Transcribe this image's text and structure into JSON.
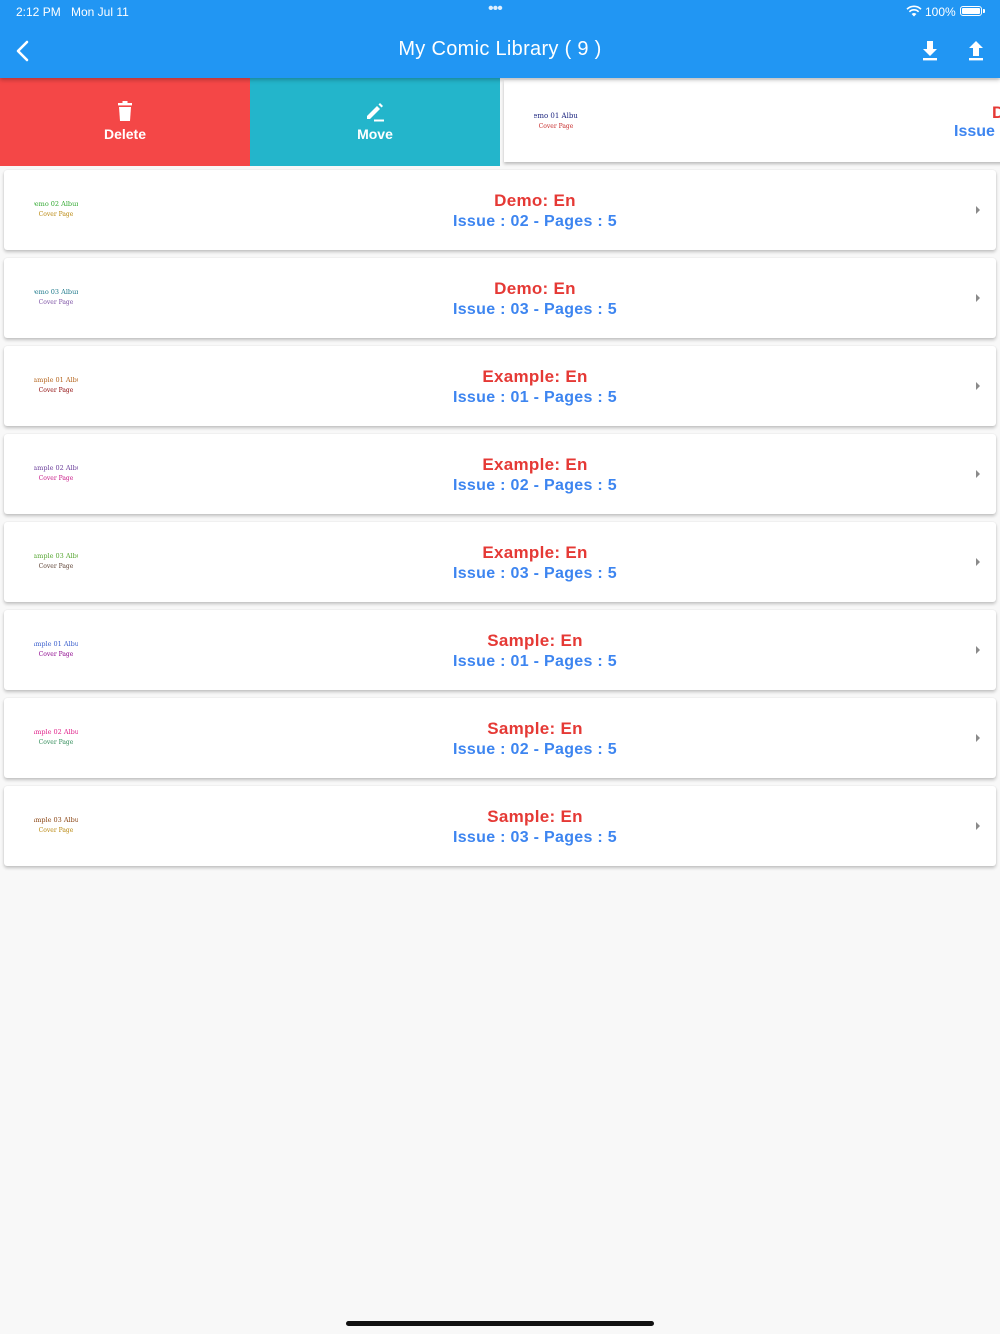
{
  "status_bar": {
    "time": "2:12 PM",
    "date": "Mon Jul 11",
    "dots": "•••",
    "battery": "100%"
  },
  "header": {
    "title": "My Comic Library ( 9 )",
    "back_icon": "chevron-left-icon",
    "download_icon": "download-icon",
    "upload_icon": "upload-icon"
  },
  "swipe_actions": {
    "delete_label": "Delete",
    "move_label": "Move"
  },
  "slid_item": {
    "title": "D",
    "subtitle": "Issue",
    "thumb_line1": "Demo 01 Album",
    "thumb_line2": "Cover Page"
  },
  "items": [
    {
      "title": "Demo: En",
      "subtitle": "Issue : 02 - Pages : 5",
      "thumb_line1": "Demo 02 Album",
      "thumb_line2": "Cover Page",
      "thumb_color1": "#33aa33",
      "thumb_color2": "#b8860b"
    },
    {
      "title": "Demo: En",
      "subtitle": "Issue : 03 - Pages : 5",
      "thumb_line1": "Demo 03 Album",
      "thumb_line2": "Cover Page",
      "thumb_color1": "#1f7a8c",
      "thumb_color2": "#7a4ea3"
    },
    {
      "title": "Example: En",
      "subtitle": "Issue : 01 - Pages : 5",
      "thumb_line1": "Example 01 Album",
      "thumb_line2": "Cover Page",
      "thumb_color1": "#b5651d",
      "thumb_color2": "#8b0000"
    },
    {
      "title": "Example: En",
      "subtitle": "Issue : 02 - Pages : 5",
      "thumb_line1": "Example 02 Album",
      "thumb_line2": "Cover Page",
      "thumb_color1": "#6a3d9a",
      "thumb_color2": "#c71585"
    },
    {
      "title": "Example: En",
      "subtitle": "Issue : 03 - Pages : 5",
      "thumb_line1": "Example 03 Album",
      "thumb_line2": "Cover Page",
      "thumb_color1": "#55a630",
      "thumb_color2": "#5c4033"
    },
    {
      "title": "Sample: En",
      "subtitle": "Issue : 01 - Pages : 5",
      "thumb_line1": "Sample 01 Album",
      "thumb_line2": "Cover Page",
      "thumb_color1": "#3a5fcd",
      "thumb_color2": "#8b008b"
    },
    {
      "title": "Sample: En",
      "subtitle": "Issue : 02 - Pages : 5",
      "thumb_line1": "Sample 02 Album",
      "thumb_line2": "Cover Page",
      "thumb_color1": "#e0218a",
      "thumb_color2": "#2e8b57"
    },
    {
      "title": "Sample: En",
      "subtitle": "Issue : 03 - Pages : 5",
      "thumb_line1": "Sample 03 Album",
      "thumb_line2": "Cover Page",
      "thumb_color1": "#8b4513",
      "thumb_color2": "#b8860b"
    }
  ],
  "colors": {
    "appbar": "#2196f3",
    "delete_action": "#f44747",
    "move_action": "#23b5cb",
    "title_text": "#e53935",
    "subtitle_text": "#3d85f0"
  }
}
